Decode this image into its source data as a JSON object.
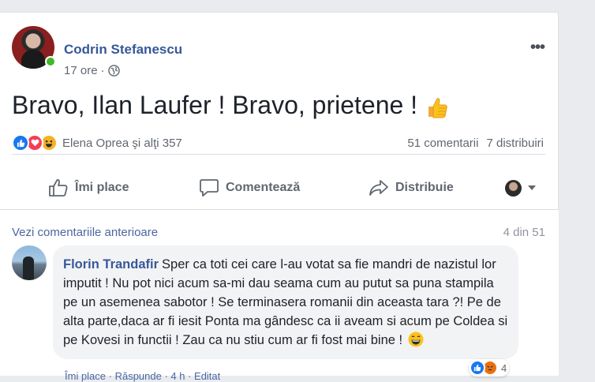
{
  "post": {
    "author": "Codrin Stefanescu",
    "time": "17 ore",
    "separator": "·",
    "text": "Bravo, Ilan Laufer ! Bravo, prietene !",
    "more_glyph": "•••",
    "privacy_icon": "globe-icon"
  },
  "reactions": {
    "names": "Elena Oprea şi alţi 357",
    "comments_count": "51 comentarii",
    "shares_count": "7 distribuiri",
    "types": [
      "like",
      "love",
      "haha"
    ]
  },
  "actions": {
    "like": "Îmi place",
    "comment": "Comentează",
    "share": "Distribuie"
  },
  "comments": {
    "view_previous": "Vezi comentariile anterioare",
    "pager": "4 din 51",
    "items": [
      {
        "author": "Florin Trandafir",
        "text": "Sper ca toti cei care l-au votat sa fie mandri de nazistul lor imputit ! Nu pot nici acum sa-mi dau seama cum au putut sa puna stampila pe un asemenea sabotor ! Se terminasera romanii din aceasta tara ?! Pe de alta parte,daca ar fi iesit Ponta ma gândesc ca ii aveam si acum pe Coldea si pe Kovesi in functii ! Zau ca nu stiu cum ar fi fost mai bine !",
        "reaction_count": "4",
        "links": "Îmi place · Răspunde · 4 h · Editat"
      }
    ]
  },
  "colors": {
    "link_blue": "#365899",
    "secondary_text": "#616770",
    "like_blue": "#1877f2",
    "love_red": "#f33e58",
    "haha_yellow": "#f7b125",
    "online_green": "#42b72a"
  }
}
